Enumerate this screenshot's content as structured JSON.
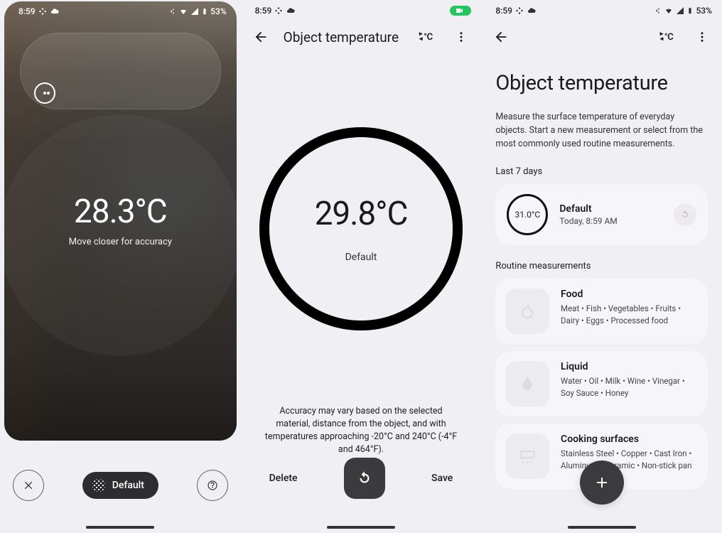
{
  "status": {
    "time": "8:59",
    "battery": "53%"
  },
  "panel1": {
    "temperature": "28.3°C",
    "hint": "Move closer for accuracy",
    "chip": "Default"
  },
  "panel2": {
    "title": "Object temperature",
    "temperature": "29.8°C",
    "label": "Default",
    "note": "Accuracy may vary based on the selected material, distance from the object, and with temperatures approaching -20°C and 240°C (-4°F and 464°F).",
    "delete": "Delete",
    "save": "Save",
    "unit_label": "°C"
  },
  "panel3": {
    "title": "Object temperature",
    "subtitle": "Measure the surface temperature of everyday objects. Start a new measurement or select from the most commonly used routine measurements.",
    "last7": "Last 7 days",
    "recent": {
      "temp": "31.0°C",
      "name": "Default",
      "time": "Today, 8:59 AM"
    },
    "section": "Routine measurements",
    "routines": [
      {
        "name": "Food",
        "desc": "Meat • Fish • Vegetables • Fruits • Dairy • Eggs • Processed food"
      },
      {
        "name": "Liquid",
        "desc": "Water • Oil • Milk • Wine • Vinegar • Soy Sauce • Honey"
      },
      {
        "name": "Cooking surfaces",
        "desc": "Stainless Steel • Copper • Cast Iron • Aluminum • Ceramic • Non-stick pan"
      }
    ],
    "unit_label": "°C"
  }
}
